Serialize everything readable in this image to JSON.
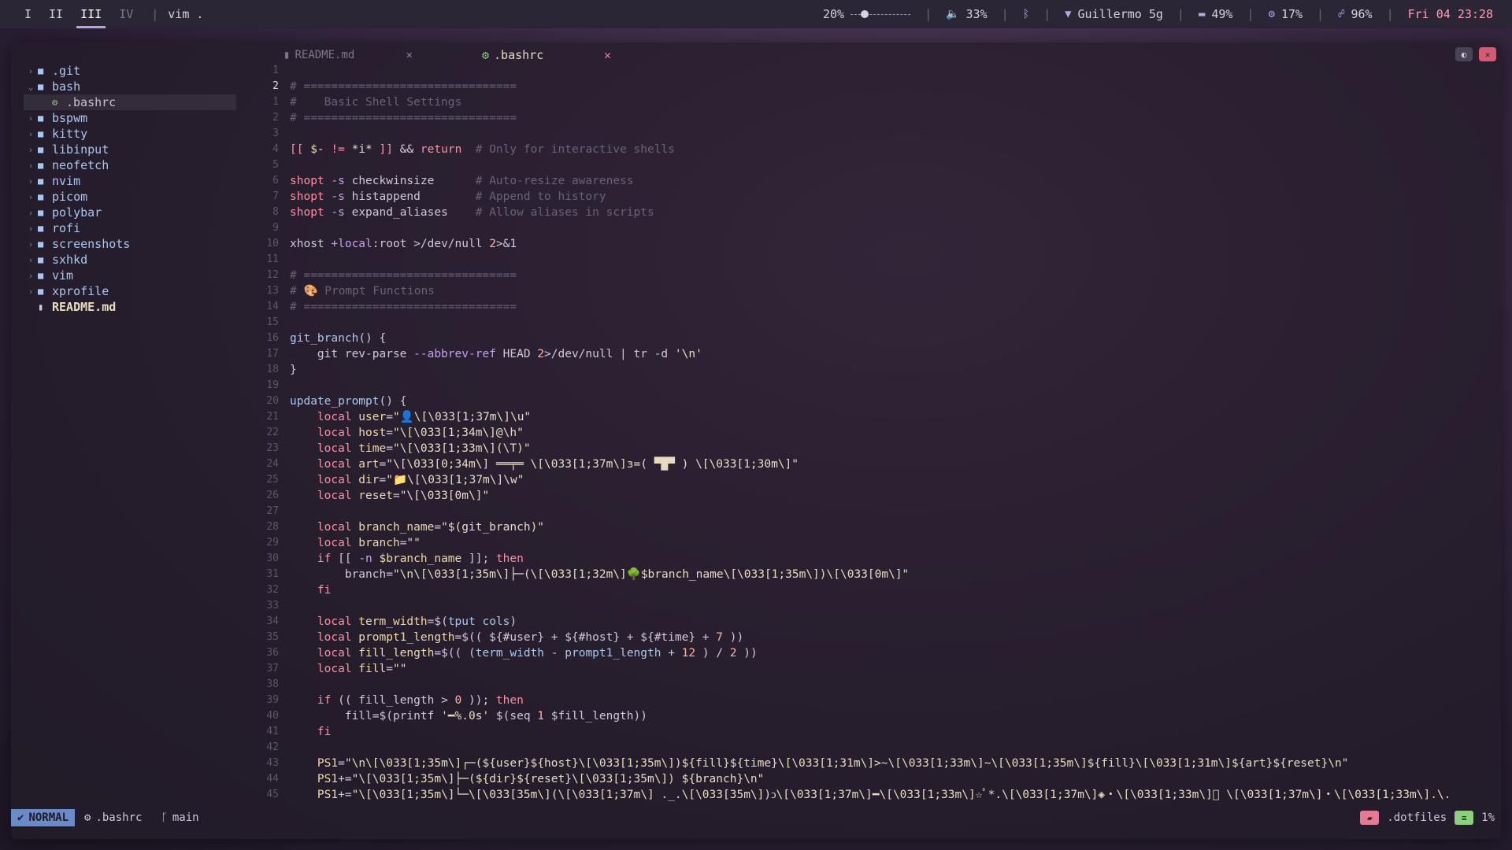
{
  "topbar": {
    "workspaces": [
      "I",
      "II",
      "III",
      "IV"
    ],
    "active_workspace": "III",
    "window_title": "vim .",
    "brightness": "20%",
    "brightness_level": 0.2,
    "volume": "33%",
    "wifi": "Guillermo 5g",
    "battery": "49%",
    "cpu": "17%",
    "memory": "96%",
    "datetime": "Fri 04 23:28"
  },
  "tree": [
    {
      "name": ".git",
      "type": "dir",
      "expanded": false
    },
    {
      "name": "bash",
      "type": "dir",
      "expanded": true
    },
    {
      "name": ".bashrc",
      "type": "cfg",
      "child": true,
      "selected": true
    },
    {
      "name": "bspwm",
      "type": "dir"
    },
    {
      "name": "kitty",
      "type": "dir"
    },
    {
      "name": "libinput",
      "type": "dir"
    },
    {
      "name": "neofetch",
      "type": "dir"
    },
    {
      "name": "nvim",
      "type": "dir"
    },
    {
      "name": "picom",
      "type": "dir"
    },
    {
      "name": "polybar",
      "type": "dir"
    },
    {
      "name": "rofi",
      "type": "dir"
    },
    {
      "name": "screenshots",
      "type": "dir"
    },
    {
      "name": "sxhkd",
      "type": "dir"
    },
    {
      "name": "vim",
      "type": "dir"
    },
    {
      "name": "xprofile",
      "type": "dir"
    },
    {
      "name": "README.md",
      "type": "file"
    }
  ],
  "tabs": [
    {
      "label": "README.md",
      "active": false
    },
    {
      "label": ".bashrc",
      "active": true
    }
  ],
  "code_lines": [
    {
      "n": "1",
      "parts": []
    },
    {
      "n": "2",
      "cur": true,
      "parts": [
        [
          "com",
          "# ==============================="
        ]
      ]
    },
    {
      "n": "1",
      "parts": [
        [
          "com",
          "#    Basic Shell Settings"
        ]
      ]
    },
    {
      "n": "2",
      "parts": [
        [
          "com",
          "# ==============================="
        ]
      ]
    },
    {
      "n": "3",
      "parts": []
    },
    {
      "n": "4",
      "parts": [
        [
          "kw",
          "[[ "
        ],
        [
          "var",
          "$-"
        ],
        [
          "kw",
          " != "
        ],
        [
          "str",
          "*i*"
        ],
        [
          "kw",
          " ]] "
        ],
        [
          "plain",
          "&& "
        ],
        [
          "kw",
          "return"
        ],
        [
          "com",
          "  # Only for interactive shells"
        ]
      ]
    },
    {
      "n": "5",
      "parts": []
    },
    {
      "n": "6",
      "parts": [
        [
          "kw",
          "shopt"
        ],
        [
          "op",
          " -s"
        ],
        [
          "plain",
          " checkwinsize      "
        ],
        [
          "com",
          "# Auto-resize awareness"
        ]
      ]
    },
    {
      "n": "7",
      "parts": [
        [
          "kw",
          "shopt"
        ],
        [
          "op",
          " -s"
        ],
        [
          "plain",
          " histappend        "
        ],
        [
          "com",
          "# Append to history"
        ]
      ]
    },
    {
      "n": "8",
      "parts": [
        [
          "kw",
          "shopt"
        ],
        [
          "op",
          " -s"
        ],
        [
          "plain",
          " expand_aliases    "
        ],
        [
          "com",
          "# Allow aliases in scripts"
        ]
      ]
    },
    {
      "n": "9",
      "parts": []
    },
    {
      "n": "10",
      "parts": [
        [
          "plain",
          "xhost "
        ],
        [
          "op",
          "+local"
        ],
        [
          "plain",
          ":root >/dev/null "
        ],
        [
          "num",
          "2"
        ],
        [
          "plain",
          ">&1"
        ]
      ]
    },
    {
      "n": "11",
      "parts": []
    },
    {
      "n": "12",
      "parts": [
        [
          "com",
          "# ==============================="
        ]
      ]
    },
    {
      "n": "13",
      "parts": [
        [
          "com",
          "# 🎨 Prompt Functions"
        ]
      ]
    },
    {
      "n": "14",
      "parts": [
        [
          "com",
          "# ==============================="
        ]
      ]
    },
    {
      "n": "15",
      "parts": []
    },
    {
      "n": "16",
      "parts": [
        [
          "fn",
          "git_branch"
        ],
        [
          "plain",
          "() {"
        ]
      ]
    },
    {
      "n": "17",
      "parts": [
        [
          "plain",
          "    git rev-parse "
        ],
        [
          "op",
          "--abbrev-ref"
        ],
        [
          "plain",
          " HEAD "
        ],
        [
          "num",
          "2"
        ],
        [
          "plain",
          ">/dev/null | tr -d "
        ],
        [
          "str",
          "'\\n'"
        ]
      ]
    },
    {
      "n": "18",
      "parts": [
        [
          "plain",
          "}"
        ]
      ]
    },
    {
      "n": "19",
      "parts": []
    },
    {
      "n": "20",
      "parts": [
        [
          "fn",
          "update_prompt"
        ],
        [
          "plain",
          "() {"
        ]
      ]
    },
    {
      "n": "21",
      "parts": [
        [
          "plain",
          "    "
        ],
        [
          "kw",
          "local"
        ],
        [
          "var",
          " user"
        ],
        [
          "plain",
          "="
        ],
        [
          "str",
          "\"👤\\[\\033[1;37m\\]\\u\""
        ]
      ]
    },
    {
      "n": "22",
      "parts": [
        [
          "plain",
          "    "
        ],
        [
          "kw",
          "local"
        ],
        [
          "var",
          " host"
        ],
        [
          "plain",
          "="
        ],
        [
          "str",
          "\"\\[\\033[1;34m\\]@\\h\""
        ]
      ]
    },
    {
      "n": "23",
      "parts": [
        [
          "plain",
          "    "
        ],
        [
          "kw",
          "local"
        ],
        [
          "var",
          " time"
        ],
        [
          "plain",
          "="
        ],
        [
          "str",
          "\"\\[\\033[1;33m\\](\\T)\""
        ]
      ]
    },
    {
      "n": "24",
      "parts": [
        [
          "plain",
          "    "
        ],
        [
          "kw",
          "local"
        ],
        [
          "var",
          " art"
        ],
        [
          "plain",
          "="
        ],
        [
          "str",
          "\"\\[\\033[0;34m\\] ══╤═ \\[\\033[1;37m\\]з=( ▀█▀ ) \\[\\033[1;30m\\]\""
        ]
      ]
    },
    {
      "n": "25",
      "parts": [
        [
          "plain",
          "    "
        ],
        [
          "kw",
          "local"
        ],
        [
          "var",
          " dir"
        ],
        [
          "plain",
          "="
        ],
        [
          "str",
          "\"📁\\[\\033[1;37m\\]\\w\""
        ]
      ]
    },
    {
      "n": "26",
      "parts": [
        [
          "plain",
          "    "
        ],
        [
          "kw",
          "local"
        ],
        [
          "var",
          " reset"
        ],
        [
          "plain",
          "="
        ],
        [
          "str",
          "\"\\[\\033[0m\\]\""
        ]
      ]
    },
    {
      "n": "27",
      "parts": []
    },
    {
      "n": "28",
      "parts": [
        [
          "plain",
          "    "
        ],
        [
          "kw",
          "local"
        ],
        [
          "var",
          " branch_name"
        ],
        [
          "plain",
          "="
        ],
        [
          "str",
          "\"$(git_branch)\""
        ]
      ]
    },
    {
      "n": "29",
      "parts": [
        [
          "plain",
          "    "
        ],
        [
          "kw",
          "local"
        ],
        [
          "var",
          " branch"
        ],
        [
          "plain",
          "="
        ],
        [
          "str",
          "\"\""
        ]
      ]
    },
    {
      "n": "30",
      "parts": [
        [
          "plain",
          "    "
        ],
        [
          "kw",
          "if"
        ],
        [
          "plain",
          " [[ "
        ],
        [
          "op",
          "-n"
        ],
        [
          "var",
          " $branch_name"
        ],
        [
          "plain",
          " ]]; "
        ],
        [
          "kw",
          "then"
        ]
      ]
    },
    {
      "n": "31",
      "parts": [
        [
          "plain",
          "        branch="
        ],
        [
          "str",
          "\"\\n\\[\\033[1;35m\\]├─(\\[\\033[1;32m\\]🌳$branch_name\\[\\033[1;35m\\])\\[\\033[0m\\]\""
        ]
      ]
    },
    {
      "n": "32",
      "parts": [
        [
          "plain",
          "    "
        ],
        [
          "kw",
          "fi"
        ]
      ]
    },
    {
      "n": "33",
      "parts": []
    },
    {
      "n": "34",
      "parts": [
        [
          "plain",
          "    "
        ],
        [
          "kw",
          "local"
        ],
        [
          "var",
          " term_width"
        ],
        [
          "plain",
          "=$("
        ],
        [
          "fn",
          "tput cols"
        ],
        [
          "plain",
          ")"
        ]
      ]
    },
    {
      "n": "35",
      "parts": [
        [
          "plain",
          "    "
        ],
        [
          "kw",
          "local"
        ],
        [
          "var",
          " prompt1_length"
        ],
        [
          "plain",
          "=$(( ${#user} + ${#host} + ${#time} + "
        ],
        [
          "num",
          "7"
        ],
        [
          "plain",
          " ))"
        ]
      ]
    },
    {
      "n": "36",
      "parts": [
        [
          "plain",
          "    "
        ],
        [
          "kw",
          "local"
        ],
        [
          "var",
          " fill_length"
        ],
        [
          "plain",
          "=$(( ("
        ],
        [
          "fn",
          "term_width"
        ],
        [
          "plain",
          " - "
        ],
        [
          "fn",
          "prompt1_length"
        ],
        [
          "plain",
          " + "
        ],
        [
          "num",
          "12"
        ],
        [
          "plain",
          " ) / "
        ],
        [
          "num",
          "2"
        ],
        [
          "plain",
          " ))"
        ]
      ]
    },
    {
      "n": "37",
      "parts": [
        [
          "plain",
          "    "
        ],
        [
          "kw",
          "local"
        ],
        [
          "var",
          " fill"
        ],
        [
          "plain",
          "="
        ],
        [
          "str",
          "\"\""
        ]
      ]
    },
    {
      "n": "38",
      "parts": []
    },
    {
      "n": "39",
      "parts": [
        [
          "plain",
          "    "
        ],
        [
          "kw",
          "if"
        ],
        [
          "plain",
          " (( fill_length > "
        ],
        [
          "num",
          "0"
        ],
        [
          "plain",
          " )); "
        ],
        [
          "kw",
          "then"
        ]
      ]
    },
    {
      "n": "40",
      "parts": [
        [
          "plain",
          "        fill=$(printf "
        ],
        [
          "str",
          "'━%.0s'"
        ],
        [
          "plain",
          " $(seq "
        ],
        [
          "num",
          "1"
        ],
        [
          "plain",
          " $fill_length))"
        ]
      ]
    },
    {
      "n": "41",
      "parts": [
        [
          "plain",
          "    "
        ],
        [
          "kw",
          "fi"
        ]
      ]
    },
    {
      "n": "42",
      "parts": []
    },
    {
      "n": "43",
      "parts": [
        [
          "plain",
          "    "
        ],
        [
          "var",
          "PS1"
        ],
        [
          "plain",
          "="
        ],
        [
          "str",
          "\"\\n\\[\\033[1;35m\\]┌─(${user}${host}\\[\\033[1;35m\\])${fill}${time}\\[\\033[1;31m\\]>~\\[\\033[1;33m\\]~\\[\\033[1;35m\\]${fill}\\[\\033[1;31m\\]${art}${reset}\\n\""
        ]
      ]
    },
    {
      "n": "44",
      "parts": [
        [
          "plain",
          "    "
        ],
        [
          "var",
          "PS1"
        ],
        [
          "plain",
          "+="
        ],
        [
          "str",
          "\"\\[\\033[1;35m\\]├─(${dir}${reset}\\[\\033[1;35m\\]) ${branch}\\n\""
        ]
      ]
    },
    {
      "n": "45",
      "parts": [
        [
          "plain",
          "    "
        ],
        [
          "var",
          "PS1"
        ],
        [
          "plain",
          "+="
        ],
        [
          "str",
          "\"\\[\\033[1;35m\\]└─\\[\\033[35m\\](\\[\\033[1;37m\\] ._.\\[\\033[35m\\])ↄ\\[\\033[1;37m\\]━\\[\\033[1;33m\\]☆ﾟ*.\\[\\033[1;37m\\]◈・\\[\\033[1;33m\\]ﾟ \\[\\033[1;37m\\]・\\[\\033[1;33m\\].\\."
        ]
      ]
    }
  ],
  "status": {
    "mode": "NORMAL",
    "file": ".bashrc",
    "branch": "main",
    "project": ".dotfiles",
    "percent": "1%"
  },
  "colors": {
    "accent": "#b9a6f0",
    "mode_bg": "#6a8ac8",
    "keyword": "#ff8fa3",
    "string": "#e8dcc0",
    "comment": "#6a6278"
  }
}
